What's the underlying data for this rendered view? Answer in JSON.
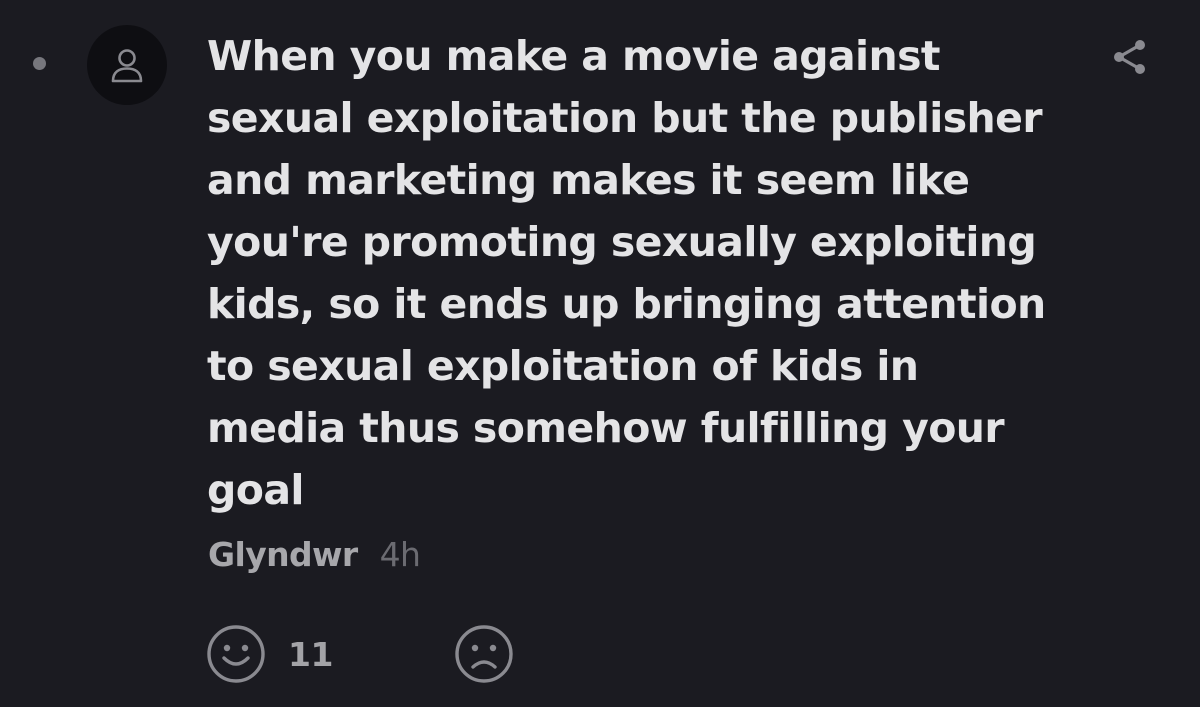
{
  "comment": {
    "text_lines": [
      "When you make a movie against",
      "sexual exploitation but the publisher",
      "and marketing makes it seem like",
      "you're promoting sexually exploiting",
      "kids, so it ends up bringing attention",
      "to sexual exploitation of kids in",
      "media thus somehow fulfilling your",
      "goal"
    ],
    "author": "Glyndwr",
    "time": "4h"
  },
  "reactions": {
    "like": {
      "icon": "smiley-face-icon",
      "count": "11"
    },
    "dislike": {
      "icon": "frowning-face-icon"
    }
  },
  "icons": {
    "avatar": "user-icon",
    "share": "share-icon"
  },
  "colors": {
    "background": "#1b1b21",
    "text": "#e4e4e6",
    "muted": "#6b6b71",
    "icon": "#8a8a90"
  }
}
